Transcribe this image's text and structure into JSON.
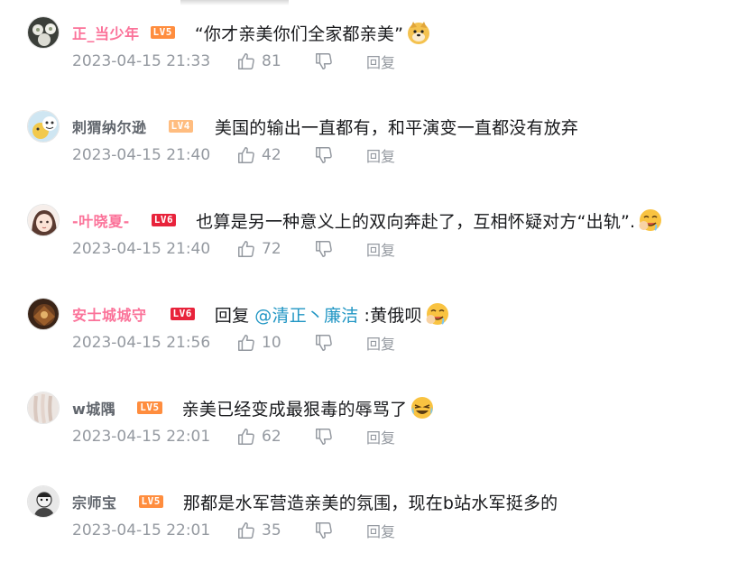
{
  "comments": [
    {
      "username": "正_当少年",
      "name_style": "vip",
      "level": "LV5",
      "text": "“你才亲美你们全家都亲美”",
      "emoji": "doge-emoji",
      "time": "2023-04-15 21:33",
      "likes": "81",
      "reply_label": "回复"
    },
    {
      "username": "刺猬纳尔逊",
      "name_style": "normal",
      "level": "LV4",
      "text": "美国的输出一直都有，和平演变一直都没有放弃",
      "emoji": "",
      "time": "2023-04-15 21:40",
      "likes": "42",
      "reply_label": "回复"
    },
    {
      "username": "-叶晓夏-",
      "name_style": "vip",
      "level": "LV6",
      "text": "也算是另一种意义上的双向奔赴了，互相怀疑对方“出轨”.",
      "emoji": "drool-emoji",
      "time": "2023-04-15 21:40",
      "likes": "72",
      "reply_label": "回复"
    },
    {
      "username": "安士城城守",
      "name_style": "vip",
      "level": "LV6",
      "reply_prefix": "回复",
      "mention": "@清正丶廉洁",
      "text": ":黄俄呗",
      "emoji": "drool-emoji",
      "time": "2023-04-15 21:56",
      "likes": "10",
      "reply_label": "回复"
    },
    {
      "username": "w城隅",
      "name_style": "normal",
      "level": "LV5",
      "text": "亲美已经变成最狠毒的辱骂了",
      "emoji": "laugh-cry-emoji",
      "time": "2023-04-15 22:01",
      "likes": "62",
      "reply_label": "回复"
    },
    {
      "username": "宗师宝",
      "name_style": "normal",
      "level": "LV5",
      "text": "那都是水军营造亲美的氛围，现在b站水军挺多的",
      "emoji": "",
      "time": "2023-04-15 22:01",
      "likes": "35",
      "reply_label": "回复"
    }
  ],
  "colors": {
    "vip_name": "#fb7299",
    "normal_name": "#61666d",
    "meta": "#9499a0",
    "mention": "#2196c4",
    "lv4": "#ffbd80",
    "lv5": "#ff8d3e",
    "lv6": "#e8233b"
  },
  "icons": {
    "like": "thumbs-up-icon",
    "dislike": "thumbs-down-icon"
  }
}
